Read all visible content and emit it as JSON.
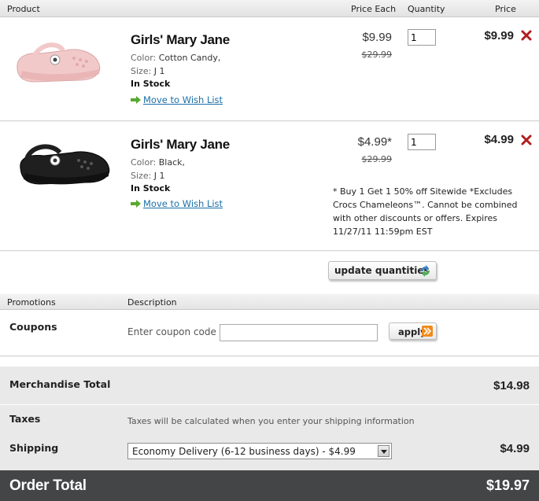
{
  "header": {
    "product": "Product",
    "price_each": "Price Each",
    "quantity": "Quantity",
    "price": "Price"
  },
  "items": [
    {
      "name": "Girls' Mary Jane",
      "color_label": "Color:",
      "color": "Cotton Candy,",
      "size_label": "Size:",
      "size": "J 1",
      "stock": "In Stock",
      "wish_link": "Move to Wish List",
      "price_each": "$9.99",
      "price_was": "$29.99",
      "quantity": "1",
      "price": "$9.99",
      "shoe_color": "#f2c9c9"
    },
    {
      "name": "Girls' Mary Jane",
      "color_label": "Color:",
      "color": "Black,",
      "size_label": "Size:",
      "size": "J 1",
      "stock": "In Stock",
      "wish_link": "Move to Wish List",
      "price_each": "$4.99*",
      "price_was": "$29.99",
      "quantity": "1",
      "price": "$4.99",
      "shoe_color": "#1f1f1f",
      "promo_note": "* Buy 1 Get 1 50% off Sitewide *Excludes Crocs Chameleons™. Cannot be combined with other discounts or offers. Expires 11/27/11 11:59pm EST"
    }
  ],
  "update_button": "update quantities",
  "promotions": {
    "header_promotions": "Promotions",
    "header_description": "Description",
    "coupons_label": "Coupons",
    "coupon_prompt": "Enter coupon code",
    "coupon_value": "",
    "apply_button": "apply"
  },
  "summary": {
    "merch_label": "Merchandise Total",
    "merch_value": "$14.98",
    "taxes_label": "Taxes",
    "taxes_note": "Taxes will be calculated when you enter your shipping information",
    "shipping_label": "Shipping",
    "shipping_option": "Economy Delivery (6-12 business days) - $4.99",
    "shipping_value": "$4.99",
    "order_total_label": "Order Total",
    "order_total_value": "$19.97"
  },
  "colors": {
    "link": "#1a6fa6",
    "remove": "#b01e1e",
    "arrow": "#5aa832",
    "order_bar": "#444547",
    "apply_icon": "#f08a1c"
  }
}
